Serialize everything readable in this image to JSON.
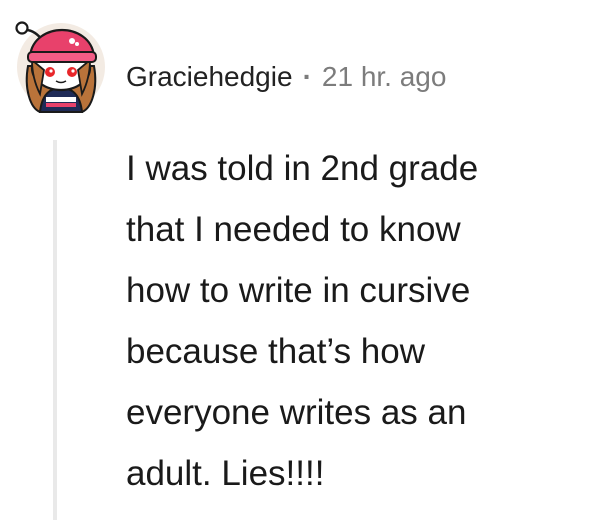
{
  "comment": {
    "author": "Graciehedgie",
    "separator": "·",
    "timestamp": "21 hr. ago",
    "avatar_icon": "snoo-avatar-icon",
    "body_lines": [
      "I was told in 2nd grade",
      "that I needed to know",
      "how to write in cursive",
      "because that’s how",
      "everyone writes as an",
      "adult. Lies!!!!"
    ]
  },
  "colors": {
    "username": "#222222",
    "meta": "#7c7c7c",
    "thread_line": "#e9e9e9",
    "avatar_hat": "#e8416b",
    "avatar_hair": "#b9733a"
  }
}
